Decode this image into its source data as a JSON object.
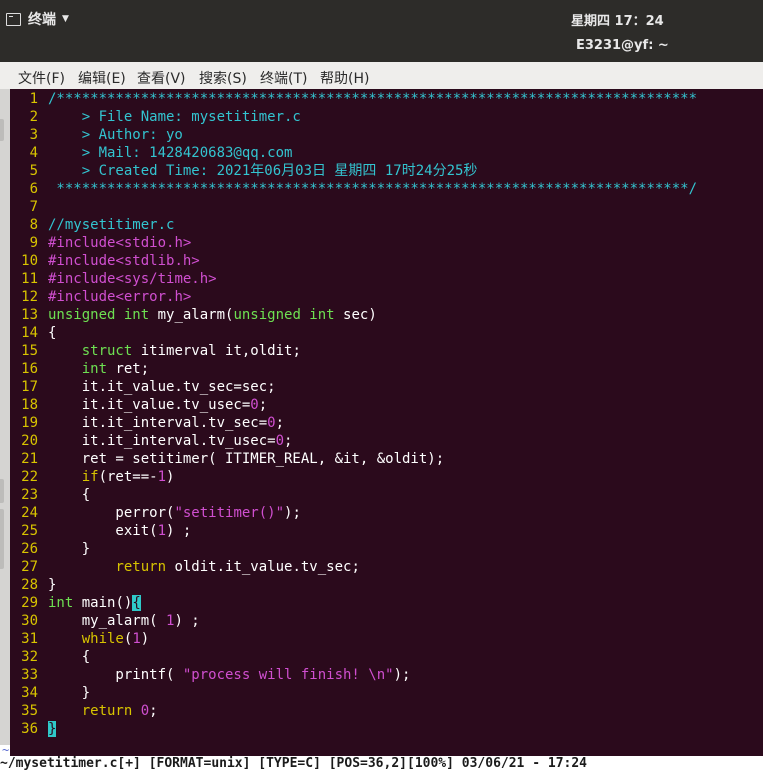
{
  "topbar": {
    "app_name": "终端",
    "clock": "星期四 17：24"
  },
  "window": {
    "title": "E3231@yf: ~"
  },
  "menu": [
    "文件(F)",
    "编辑(E)",
    "查看(V)",
    "搜索(S)",
    "终端(T)",
    "帮助(H)"
  ],
  "colors": {
    "background": "#2b0a1c",
    "line_number": "#d8c400",
    "comment": "#33c4d0",
    "preprocessor": "#d04fd0",
    "type": "#6ee052",
    "keyword": "#d8c400",
    "cursor": "#2fc9c9"
  },
  "editor": {
    "lines": [
      {
        "n": "1",
        "tokens": [
          {
            "t": "/****************************************************************************",
            "c": "comment"
          }
        ]
      },
      {
        "n": "2",
        "tokens": [
          {
            "t": "    > File Name: mysetitimer.c",
            "c": "comment"
          }
        ]
      },
      {
        "n": "3",
        "tokens": [
          {
            "t": "    > Author: yo",
            "c": "comment"
          }
        ]
      },
      {
        "n": "4",
        "tokens": [
          {
            "t": "    > Mail: 1428420683@qq.com",
            "c": "comment"
          }
        ]
      },
      {
        "n": "5",
        "tokens": [
          {
            "t": "    > Created Time: 2021年06月03日 星期四 17时24分25秒",
            "c": "comment"
          }
        ]
      },
      {
        "n": "6",
        "tokens": [
          {
            "t": " ***************************************************************************/",
            "c": "comment"
          }
        ]
      },
      {
        "n": "7",
        "tokens": []
      },
      {
        "n": "8",
        "tokens": [
          {
            "t": "//mysetitimer.c",
            "c": "comment"
          }
        ]
      },
      {
        "n": "9",
        "tokens": [
          {
            "t": "#include",
            "c": "pre"
          },
          {
            "t": "<stdio.h>",
            "c": "str"
          }
        ]
      },
      {
        "n": "10",
        "tokens": [
          {
            "t": "#include",
            "c": "pre"
          },
          {
            "t": "<stdlib.h>",
            "c": "str"
          }
        ]
      },
      {
        "n": "11",
        "tokens": [
          {
            "t": "#include",
            "c": "pre"
          },
          {
            "t": "<sys/time.h>",
            "c": "str"
          }
        ]
      },
      {
        "n": "12",
        "tokens": [
          {
            "t": "#include",
            "c": "pre"
          },
          {
            "t": "<error.h>",
            "c": "str"
          }
        ]
      },
      {
        "n": "13",
        "tokens": [
          {
            "t": "unsigned int",
            "c": "type"
          },
          {
            "t": " my_alarm(",
            "c": ""
          },
          {
            "t": "unsigned int",
            "c": "type"
          },
          {
            "t": " sec)",
            "c": ""
          }
        ]
      },
      {
        "n": "14",
        "tokens": [
          {
            "t": "{",
            "c": ""
          }
        ]
      },
      {
        "n": "15",
        "tokens": [
          {
            "t": "    ",
            "c": ""
          },
          {
            "t": "struct",
            "c": "type"
          },
          {
            "t": " itimerval it,oldit;",
            "c": ""
          }
        ]
      },
      {
        "n": "16",
        "tokens": [
          {
            "t": "    ",
            "c": ""
          },
          {
            "t": "int",
            "c": "type"
          },
          {
            "t": " ret;",
            "c": ""
          }
        ]
      },
      {
        "n": "17",
        "tokens": [
          {
            "t": "    it.it_value.tv_sec=sec;",
            "c": ""
          }
        ]
      },
      {
        "n": "18",
        "tokens": [
          {
            "t": "    it.it_value.tv_usec=",
            "c": ""
          },
          {
            "t": "0",
            "c": "num"
          },
          {
            "t": ";",
            "c": ""
          }
        ]
      },
      {
        "n": "19",
        "tokens": [
          {
            "t": "    it.it_interval.tv_sec=",
            "c": ""
          },
          {
            "t": "0",
            "c": "num"
          },
          {
            "t": ";",
            "c": ""
          }
        ]
      },
      {
        "n": "20",
        "tokens": [
          {
            "t": "    it.it_interval.tv_usec=",
            "c": ""
          },
          {
            "t": "0",
            "c": "num"
          },
          {
            "t": ";",
            "c": ""
          }
        ]
      },
      {
        "n": "21",
        "tokens": [
          {
            "t": "    ret = setitimer( ITIMER_REAL, &it, &oldit);",
            "c": ""
          }
        ]
      },
      {
        "n": "22",
        "tokens": [
          {
            "t": "    ",
            "c": ""
          },
          {
            "t": "if",
            "c": "kw"
          },
          {
            "t": "(ret==-",
            "c": ""
          },
          {
            "t": "1",
            "c": "num"
          },
          {
            "t": ")",
            "c": ""
          }
        ]
      },
      {
        "n": "23",
        "tokens": [
          {
            "t": "    {",
            "c": ""
          }
        ]
      },
      {
        "n": "24",
        "tokens": [
          {
            "t": "        perror(",
            "c": ""
          },
          {
            "t": "\"setitimer()\"",
            "c": "str"
          },
          {
            "t": ");",
            "c": ""
          }
        ]
      },
      {
        "n": "25",
        "tokens": [
          {
            "t": "        exit(",
            "c": ""
          },
          {
            "t": "1",
            "c": "num"
          },
          {
            "t": ") ;",
            "c": ""
          }
        ]
      },
      {
        "n": "26",
        "tokens": [
          {
            "t": "    }",
            "c": ""
          }
        ]
      },
      {
        "n": "27",
        "tokens": [
          {
            "t": "        ",
            "c": ""
          },
          {
            "t": "return",
            "c": "kw"
          },
          {
            "t": " oldit.it_value.tv_sec;",
            "c": ""
          }
        ]
      },
      {
        "n": "28",
        "tokens": [
          {
            "t": "}",
            "c": ""
          }
        ]
      },
      {
        "n": "29",
        "tokens": [
          {
            "t": "int",
            "c": "type"
          },
          {
            "t": " main()",
            "c": ""
          },
          {
            "t": "{",
            "c": "cur"
          }
        ]
      },
      {
        "n": "30",
        "tokens": [
          {
            "t": "    my_alarm( ",
            "c": ""
          },
          {
            "t": "1",
            "c": "num"
          },
          {
            "t": ") ;",
            "c": ""
          }
        ]
      },
      {
        "n": "31",
        "tokens": [
          {
            "t": "    ",
            "c": ""
          },
          {
            "t": "while",
            "c": "kw"
          },
          {
            "t": "(",
            "c": ""
          },
          {
            "t": "1",
            "c": "num"
          },
          {
            "t": ")",
            "c": ""
          }
        ]
      },
      {
        "n": "32",
        "tokens": [
          {
            "t": "    {",
            "c": ""
          }
        ]
      },
      {
        "n": "33",
        "tokens": [
          {
            "t": "        printf( ",
            "c": ""
          },
          {
            "t": "\"process will finish! \\n\"",
            "c": "str"
          },
          {
            "t": ");",
            "c": ""
          }
        ]
      },
      {
        "n": "34",
        "tokens": [
          {
            "t": "    }",
            "c": ""
          }
        ]
      },
      {
        "n": "35",
        "tokens": [
          {
            "t": "    ",
            "c": ""
          },
          {
            "t": "return",
            "c": "kw"
          },
          {
            "t": " ",
            "c": ""
          },
          {
            "t": "0",
            "c": "num"
          },
          {
            "t": ";",
            "c": ""
          }
        ]
      },
      {
        "n": "36",
        "tokens": [
          {
            "t": "}",
            "c": "cur"
          }
        ]
      }
    ],
    "tilde": "~",
    "status": "~/mysetitimer.c[+] [FORMAT=unix] [TYPE=C] [POS=36,2][100%] 03/06/21 - 17:24"
  }
}
